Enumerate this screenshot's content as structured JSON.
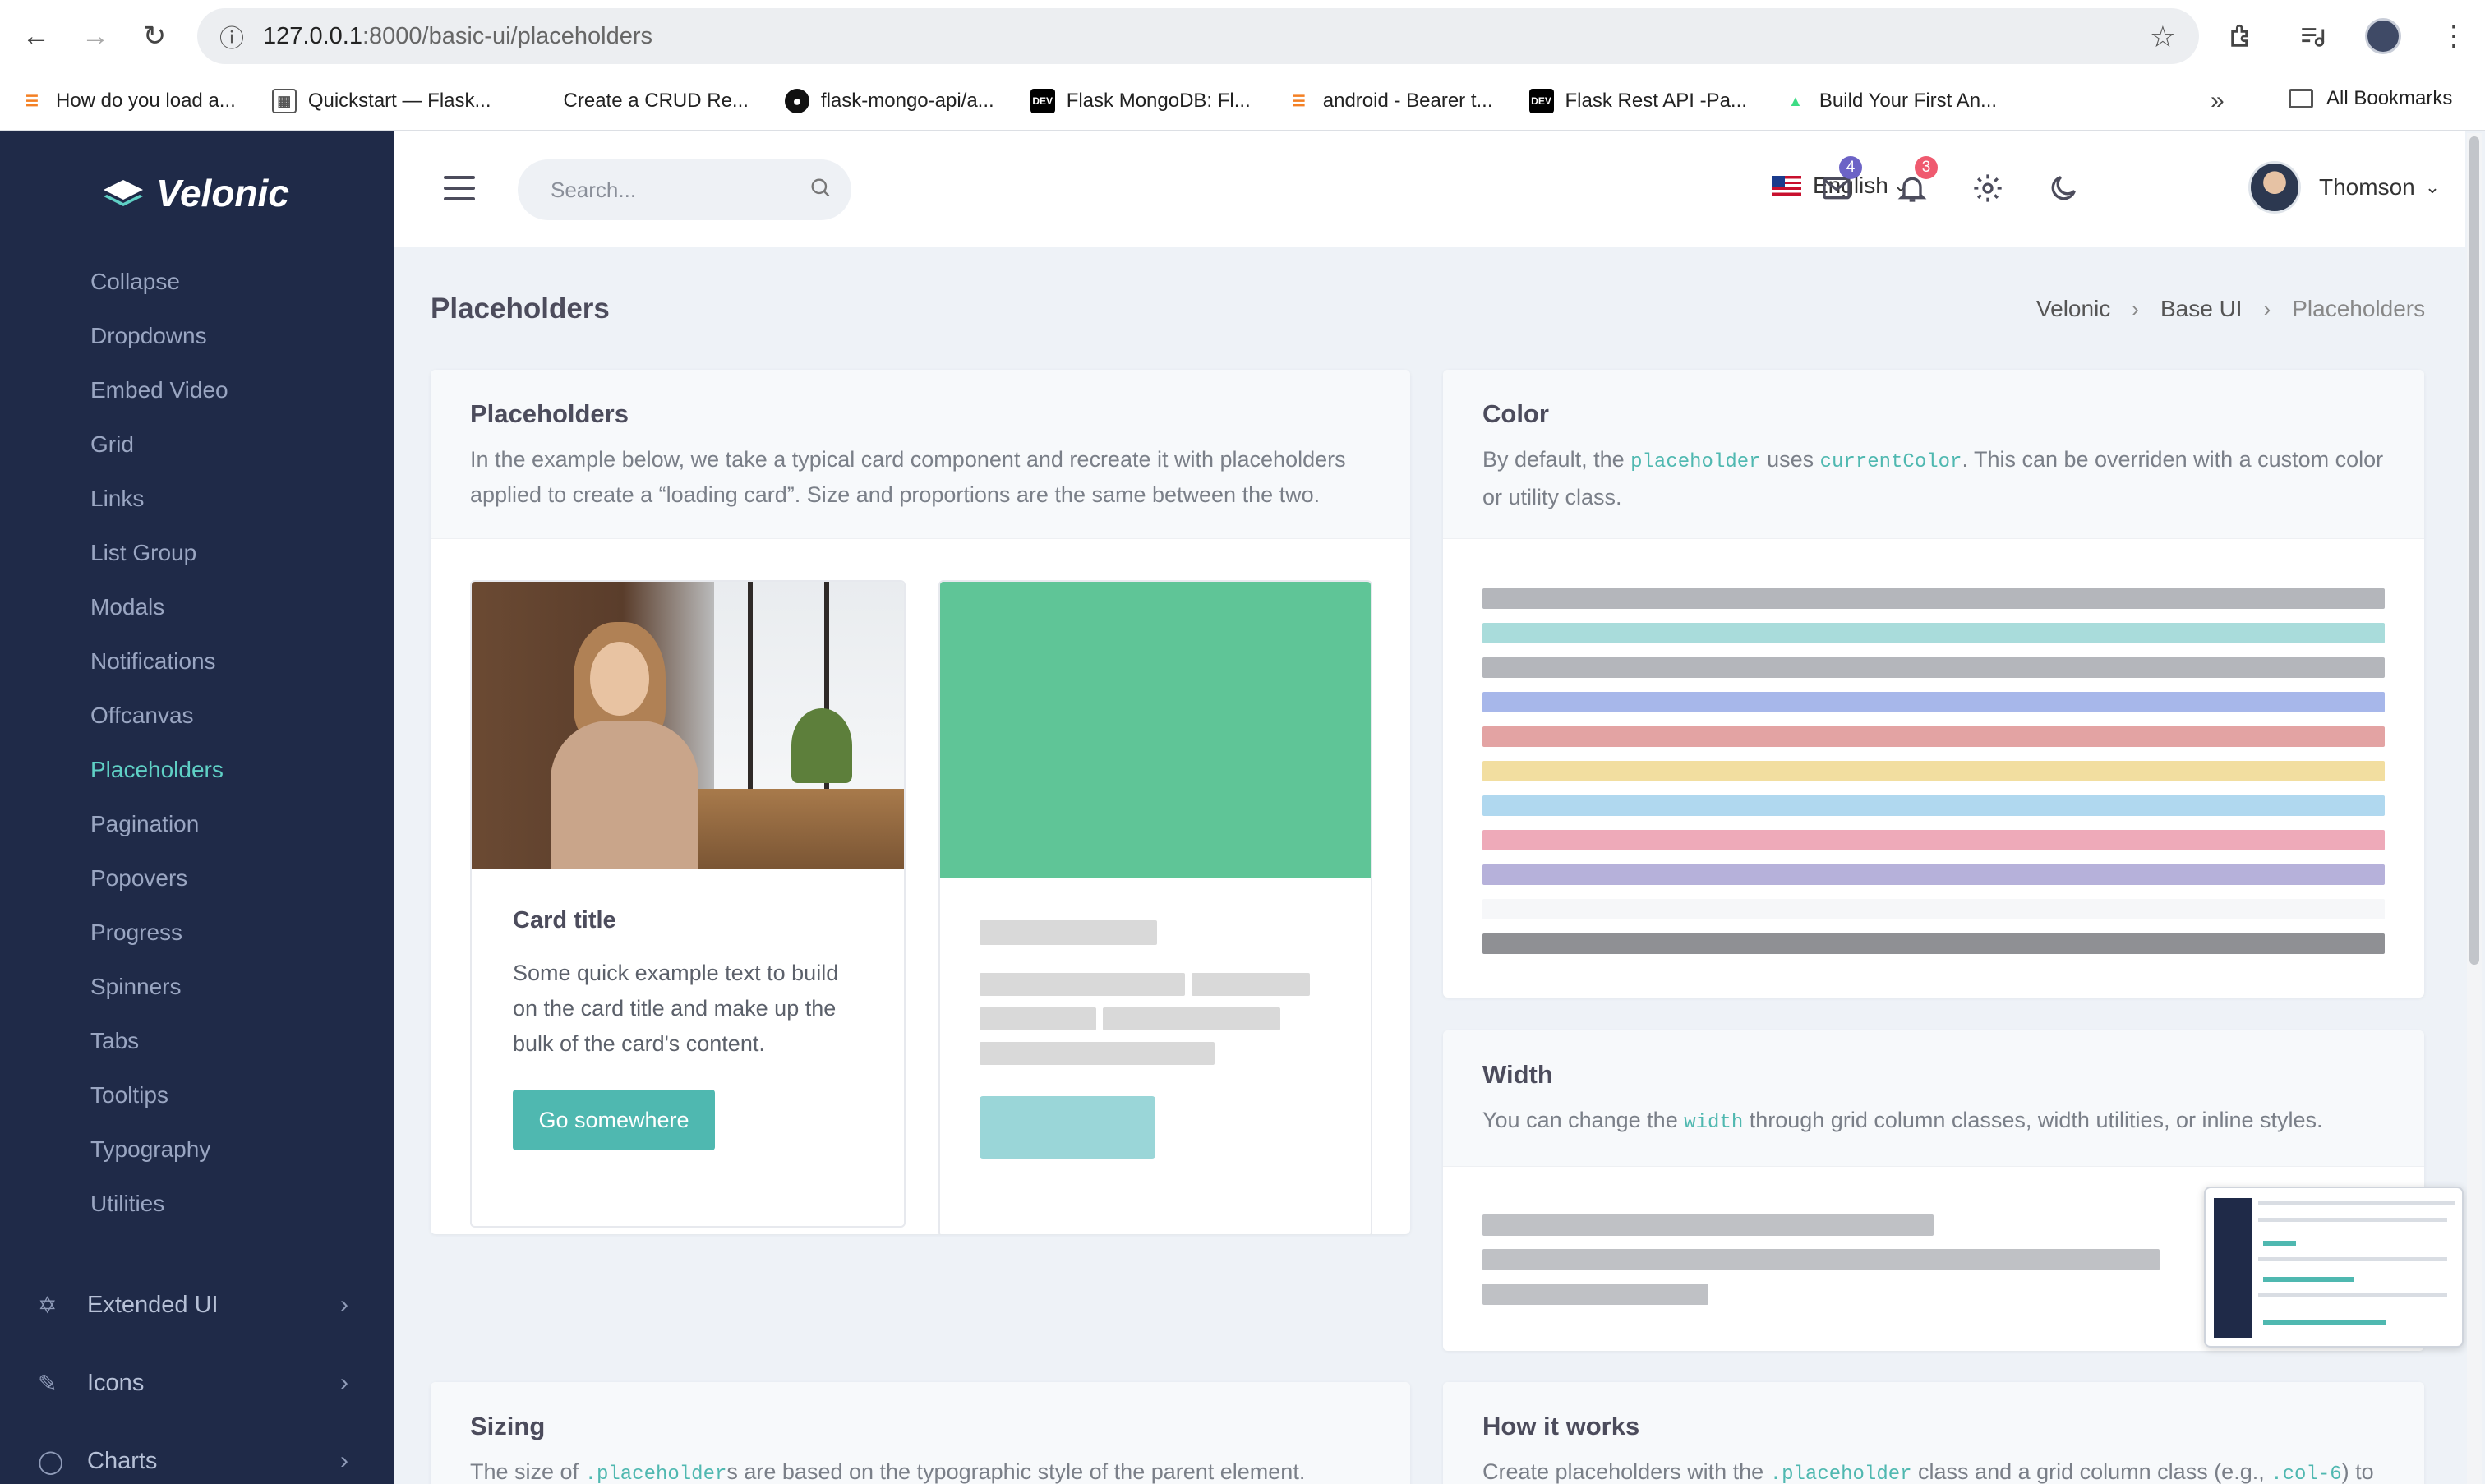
{
  "browser": {
    "url_host": "127.0.0.1",
    "url_path": ":8000/basic-ui/placeholders",
    "bookmarks": [
      {
        "label": "How do you load a...",
        "icon": "stackoverflow-icon",
        "color": "#f48024"
      },
      {
        "label": "Quickstart — Flask...",
        "icon": "docs-icon",
        "color": "#555555"
      },
      {
        "label": "Create a CRUD Re...",
        "icon": "blank-icon",
        "color": "#ffffff"
      },
      {
        "label": "flask-mongo-api/a...",
        "icon": "github-icon",
        "color": "#111111"
      },
      {
        "label": "Flask MongoDB: Fl...",
        "icon": "dev-icon",
        "color": "#000000"
      },
      {
        "label": "android - Bearer t...",
        "icon": "stackoverflow-icon",
        "color": "#f48024"
      },
      {
        "label": "Flask Rest API -Pa...",
        "icon": "dev-icon",
        "color": "#000000"
      },
      {
        "label": "Build Your First An...",
        "icon": "android-icon",
        "color": "#3ddc84"
      }
    ],
    "all_bookmarks": "All Bookmarks"
  },
  "sidebar": {
    "brand": "Velonic",
    "items": [
      {
        "label": "Collapse",
        "active": false
      },
      {
        "label": "Dropdowns",
        "active": false
      },
      {
        "label": "Embed Video",
        "active": false
      },
      {
        "label": "Grid",
        "active": false
      },
      {
        "label": "Links",
        "active": false
      },
      {
        "label": "List Group",
        "active": false
      },
      {
        "label": "Modals",
        "active": false
      },
      {
        "label": "Notifications",
        "active": false
      },
      {
        "label": "Offcanvas",
        "active": false
      },
      {
        "label": "Placeholders",
        "active": true
      },
      {
        "label": "Pagination",
        "active": false
      },
      {
        "label": "Popovers",
        "active": false
      },
      {
        "label": "Progress",
        "active": false
      },
      {
        "label": "Spinners",
        "active": false
      },
      {
        "label": "Tabs",
        "active": false
      },
      {
        "label": "Tooltips",
        "active": false
      },
      {
        "label": "Typography",
        "active": false
      },
      {
        "label": "Utilities",
        "active": false
      }
    ],
    "groups": [
      {
        "label": "Extended UI",
        "icon": "ribbon-icon"
      },
      {
        "label": "Icons",
        "icon": "pencil-ruler-icon"
      },
      {
        "label": "Charts",
        "icon": "donut-chart-icon"
      }
    ]
  },
  "topbar": {
    "search_placeholder": "Search...",
    "language": "English",
    "mail_count": "4",
    "notification_count": "3",
    "user_name": "Thomson"
  },
  "page": {
    "title": "Placeholders",
    "breadcrumb": [
      "Velonic",
      "Base UI",
      "Placeholders"
    ]
  },
  "cards": {
    "placeholders": {
      "title": "Placeholders",
      "desc": "In the example below, we take a typical card component and recreate it with placeholders applied to create a “loading card”. Size and proportions are the same between the two.",
      "example": {
        "card_title": "Card title",
        "card_text": "Some quick example text to build on the card title and make up the bulk of the card's content.",
        "button": "Go somewhere"
      }
    },
    "color": {
      "title": "Color",
      "desc_1": "By default, the ",
      "code_1": "placeholder",
      "desc_2": " uses ",
      "code_2": "currentColor",
      "desc_3": ". This can be overriden with a custom color or utility class.",
      "bars": [
        "#b4b6bb",
        "#a9dcdb",
        "#b4b6bb",
        "#a7b7ea",
        "#e3a3a3",
        "#f2dea0",
        "#b0d8ef",
        "#eeaab9",
        "#b6b1da",
        "#f6f7f9",
        "#8f9094"
      ]
    },
    "width": {
      "title": "Width",
      "desc_1": "You can change the ",
      "code_1": "width",
      "desc_2": " through grid column classes, width utilities, or inline styles.",
      "bar_fractions": [
        0.5,
        0.75,
        0.25
      ]
    },
    "sizing": {
      "title": "Sizing",
      "desc_1": "The size of ",
      "code_1": ".placeholder",
      "desc_2": "s are based on the typographic style of the parent element."
    },
    "how": {
      "title": "How it works",
      "desc_1": "Create placeholders with the ",
      "code_1": ".placeholder",
      "desc_2": " class and a grid column class (e.g., ",
      "code_2": ".col-6",
      "desc_3": ") to"
    }
  },
  "colors": {
    "sidebar": "#1f2a48",
    "accent": "#4fb8b0",
    "placeholder_green": "#5fc597",
    "placeholder_teal": "#9ad6d8",
    "placeholder_gray": "#d9d9d9"
  }
}
